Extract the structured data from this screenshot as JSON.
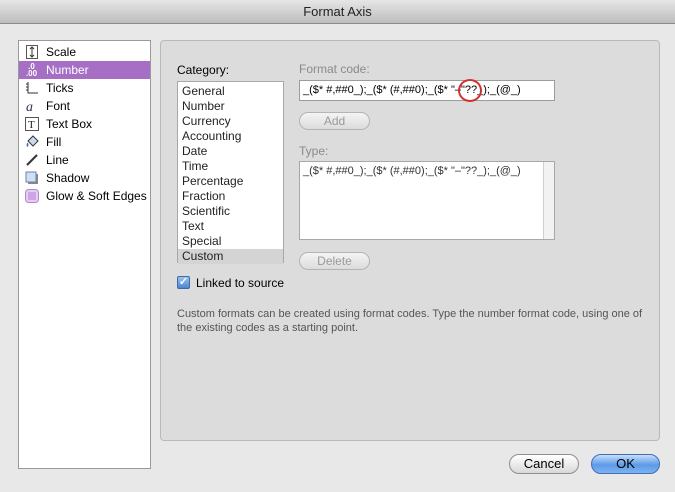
{
  "window": {
    "title": "Format Axis"
  },
  "sidebar": {
    "items": [
      {
        "label": "Scale",
        "icon": "scale-icon"
      },
      {
        "label": "Number",
        "icon": "number-format-icon"
      },
      {
        "label": "Ticks",
        "icon": "ticks-icon"
      },
      {
        "label": "Font",
        "icon": "font-icon"
      },
      {
        "label": "Text Box",
        "icon": "text-box-icon"
      },
      {
        "label": "Fill",
        "icon": "fill-icon"
      },
      {
        "label": "Line",
        "icon": "line-icon"
      },
      {
        "label": "Shadow",
        "icon": "shadow-icon"
      },
      {
        "label": "Glow & Soft Edges",
        "icon": "glow-icon"
      }
    ],
    "selected": "Number",
    "icon_glyphs": {
      "number": ".0\n.00",
      "font": "a",
      "text_box": "T"
    }
  },
  "number_panel": {
    "category_label": "Category:",
    "categories": [
      "General",
      "Number",
      "Currency",
      "Accounting",
      "Date",
      "Time",
      "Percentage",
      "Fraction",
      "Scientific",
      "Text",
      "Special",
      "Custom"
    ],
    "selected_category": "Custom",
    "format_code_label": "Format code:",
    "format_code_value": "_($* #,##0_);_($* (#,##0);_($* \"–\"??_);_(@_)",
    "add_label": "Add",
    "type_label": "Type:",
    "types": [
      "_($* #,##0_);_($* (#,##0);_($* \"–\"??_);_(@_)"
    ],
    "delete_label": "Delete",
    "linked_to_source_label": "Linked to source",
    "linked_to_source_checked": true,
    "hint_text": "Custom formats can be created using format codes. Type the number format code, using one of the existing codes as a starting point."
  },
  "buttons": {
    "cancel": "Cancel",
    "ok": "OK"
  },
  "colors": {
    "selection": "#a66ec4",
    "default_button": "#5b9be8",
    "annotation_circle": "#d03030"
  }
}
